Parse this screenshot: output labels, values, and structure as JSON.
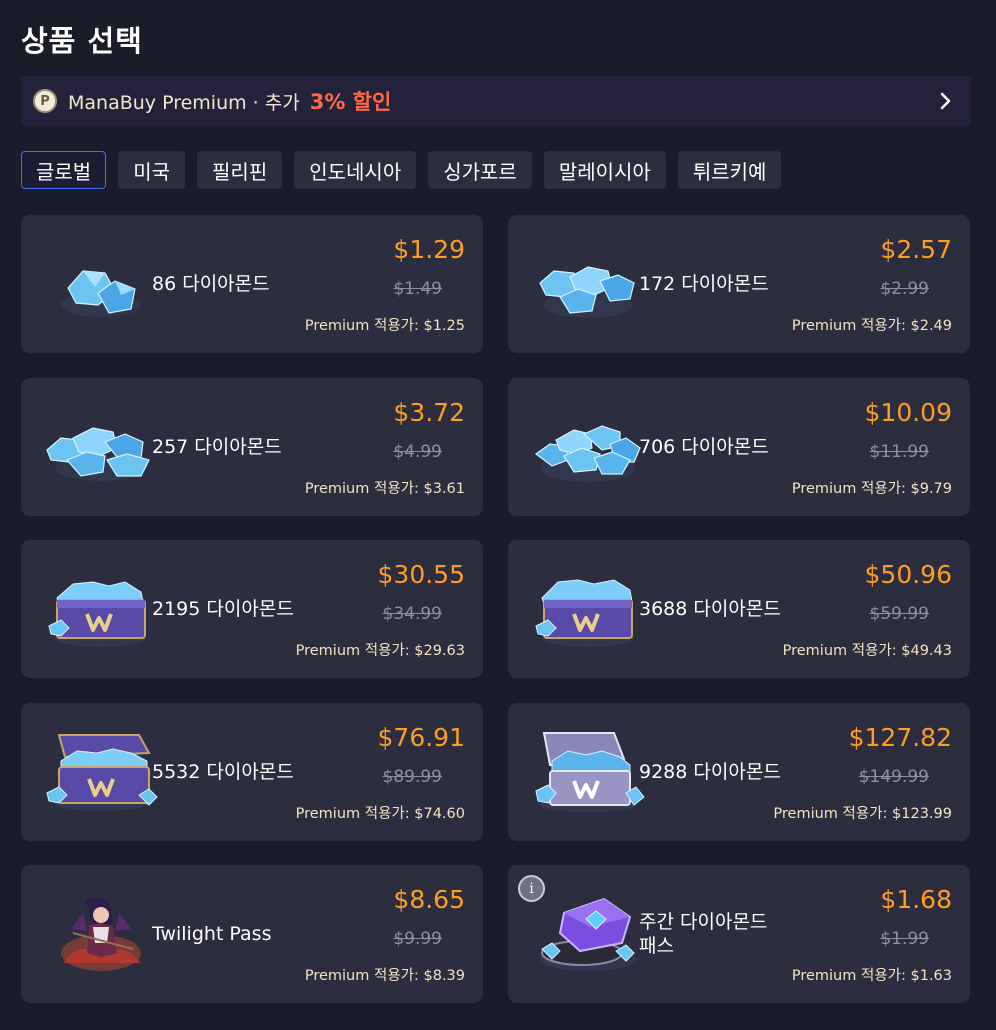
{
  "header": {
    "title": "상품 선택"
  },
  "premium": {
    "logo_letter": "P",
    "text": "ManaBuy Premium · 추가",
    "discount": "3% 할인"
  },
  "tabs": [
    {
      "label": "글로벌",
      "active": true
    },
    {
      "label": "미국"
    },
    {
      "label": "필리핀"
    },
    {
      "label": "인도네시아"
    },
    {
      "label": "싱가포르"
    },
    {
      "label": "말레이시아"
    },
    {
      "label": "튀르키예"
    }
  ],
  "products": [
    {
      "name": "86 다이아몬드",
      "price": "$1.29",
      "original": "$1.49",
      "premium": "Premium 적용가: $1.25",
      "icon": "diamond-small-icon"
    },
    {
      "name": "172 다이아몬드",
      "price": "$2.57",
      "original": "$2.99",
      "premium": "Premium 적용가: $2.49",
      "icon": "diamond-pile-icon"
    },
    {
      "name": "257 다이아몬드",
      "price": "$3.72",
      "original": "$4.99",
      "premium": "Premium 적용가: $3.61",
      "icon": "diamond-pile-icon"
    },
    {
      "name": "706 다이아몬드",
      "price": "$10.09",
      "original": "$11.99",
      "premium": "Premium 적용가: $9.79",
      "icon": "diamond-pile-large-icon"
    },
    {
      "name": "2195 다이아몬드",
      "price": "$30.55",
      "original": "$34.99",
      "premium": "Premium 적용가: $29.63",
      "icon": "diamond-chest-icon"
    },
    {
      "name": "3688 다이아몬드",
      "price": "$50.96",
      "original": "$59.99",
      "premium": "Premium 적용가: $49.43",
      "icon": "diamond-chest-icon"
    },
    {
      "name": "5532 다이아몬드",
      "price": "$76.91",
      "original": "$89.99",
      "premium": "Premium 적용가: $74.60",
      "icon": "diamond-chest-open-icon"
    },
    {
      "name": "9288 다이아몬드",
      "price": "$127.82",
      "original": "$149.99",
      "premium": "Premium 적용가: $123.99",
      "icon": "diamond-chest-silver-icon"
    },
    {
      "name": "Twilight Pass",
      "price": "$8.65",
      "original": "$9.99",
      "premium": "Premium 적용가: $8.39",
      "icon": "twilight-pass-hero-icon"
    },
    {
      "name": "주간 다이아몬드 패스",
      "price": "$1.68",
      "original": "$1.99",
      "premium": "Premium 적용가: $1.63",
      "icon": "weekly-pass-box-icon",
      "info": "i"
    }
  ],
  "colors": {
    "background": "#1b1c29",
    "card": "#2c2d3e",
    "price": "#ff9d20",
    "discount": "#ff6a45",
    "active_tab_border": "#3d6ef5"
  }
}
